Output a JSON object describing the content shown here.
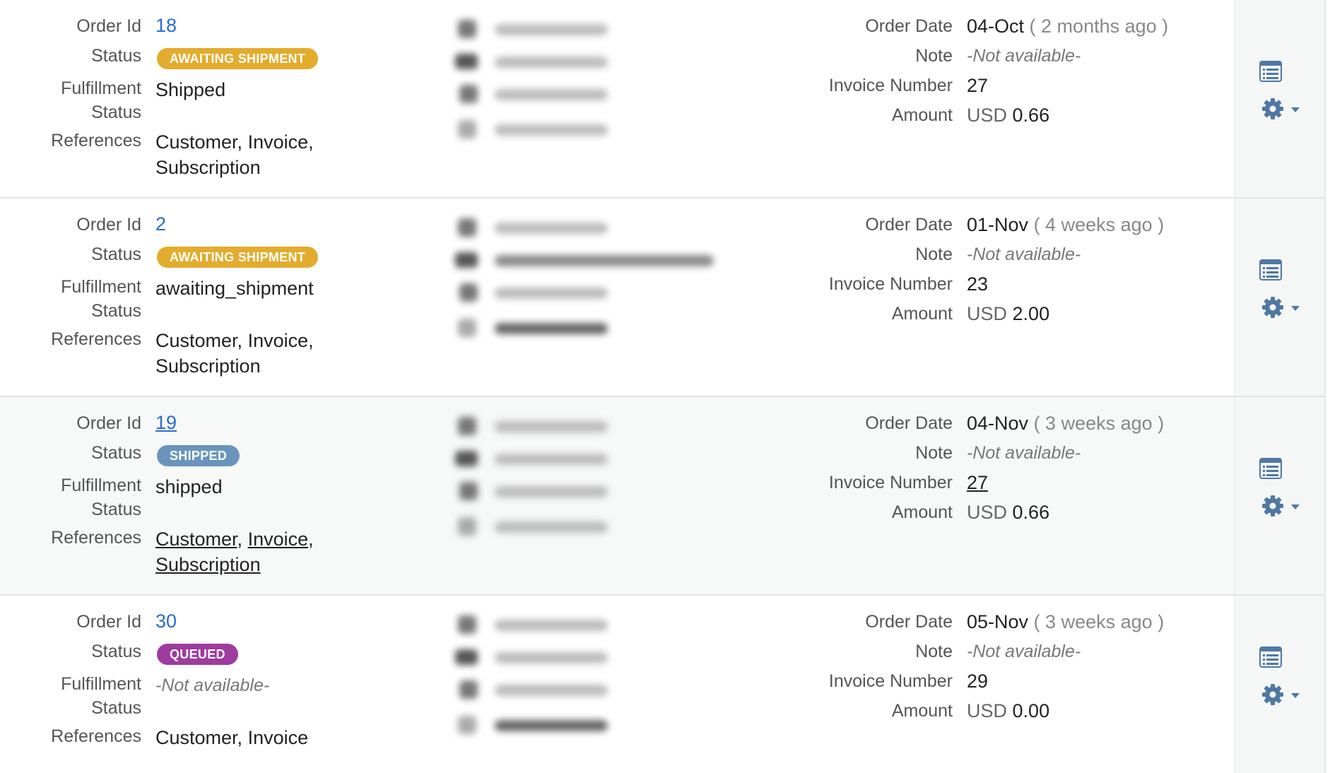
{
  "labels": {
    "order_id": "Order Id",
    "status": "Status",
    "fulfillment_line1": "Fulfillment",
    "fulfillment_line2": "Status",
    "references": "References",
    "order_date": "Order Date",
    "note": "Note",
    "invoice_number": "Invoice Number",
    "amount": "Amount"
  },
  "colors": {
    "awaiting_shipment": "#e3ac2c",
    "shipped": "#6995bd",
    "queued": "#9e3b9e",
    "link": "#2a6bd1"
  },
  "orders": [
    {
      "order_id": "18",
      "status": "AWAITING SHIPMENT",
      "fulfillment": "Shipped",
      "refs_a": "Customer",
      "refs_b": "Invoice",
      "refs_c": "Subscription",
      "order_date": "04-Oct",
      "relative": "( 2 months ago )",
      "note": "-Not available-",
      "invoice_number": "27",
      "currency": "USD",
      "amount": "0.66"
    },
    {
      "order_id": "2",
      "status": "AWAITING SHIPMENT",
      "fulfillment": "awaiting_shipment",
      "refs_a": "Customer",
      "refs_b": "Invoice",
      "refs_c": "Subscription",
      "order_date": "01-Nov",
      "relative": "( 4 weeks ago )",
      "note": "-Not available-",
      "invoice_number": "23",
      "currency": "USD",
      "amount": "2.00"
    },
    {
      "order_id": "19",
      "status": "SHIPPED",
      "fulfillment": "shipped",
      "refs_a": "Customer",
      "refs_b": "Invoice",
      "refs_c": "Subscription",
      "order_date": "04-Nov",
      "relative": "( 3 weeks ago )",
      "note": "-Not available-",
      "invoice_number": "27",
      "currency": "USD",
      "amount": "0.66"
    },
    {
      "order_id": "30",
      "status": "QUEUED",
      "fulfillment": "-Not available-",
      "refs_a": "Customer",
      "refs_b": "Invoice",
      "order_date": "05-Nov",
      "relative": "( 3 weeks ago )",
      "note": "-Not available-",
      "invoice_number": "29",
      "currency": "USD",
      "amount": "0.00"
    }
  ],
  "icons": {
    "details": "list-icon",
    "settings": "gear-icon",
    "menu": "chevron-down-icon",
    "blurred_contact": [
      "user-icon",
      "email-icon",
      "id-card-icon",
      "phone-icon"
    ]
  }
}
